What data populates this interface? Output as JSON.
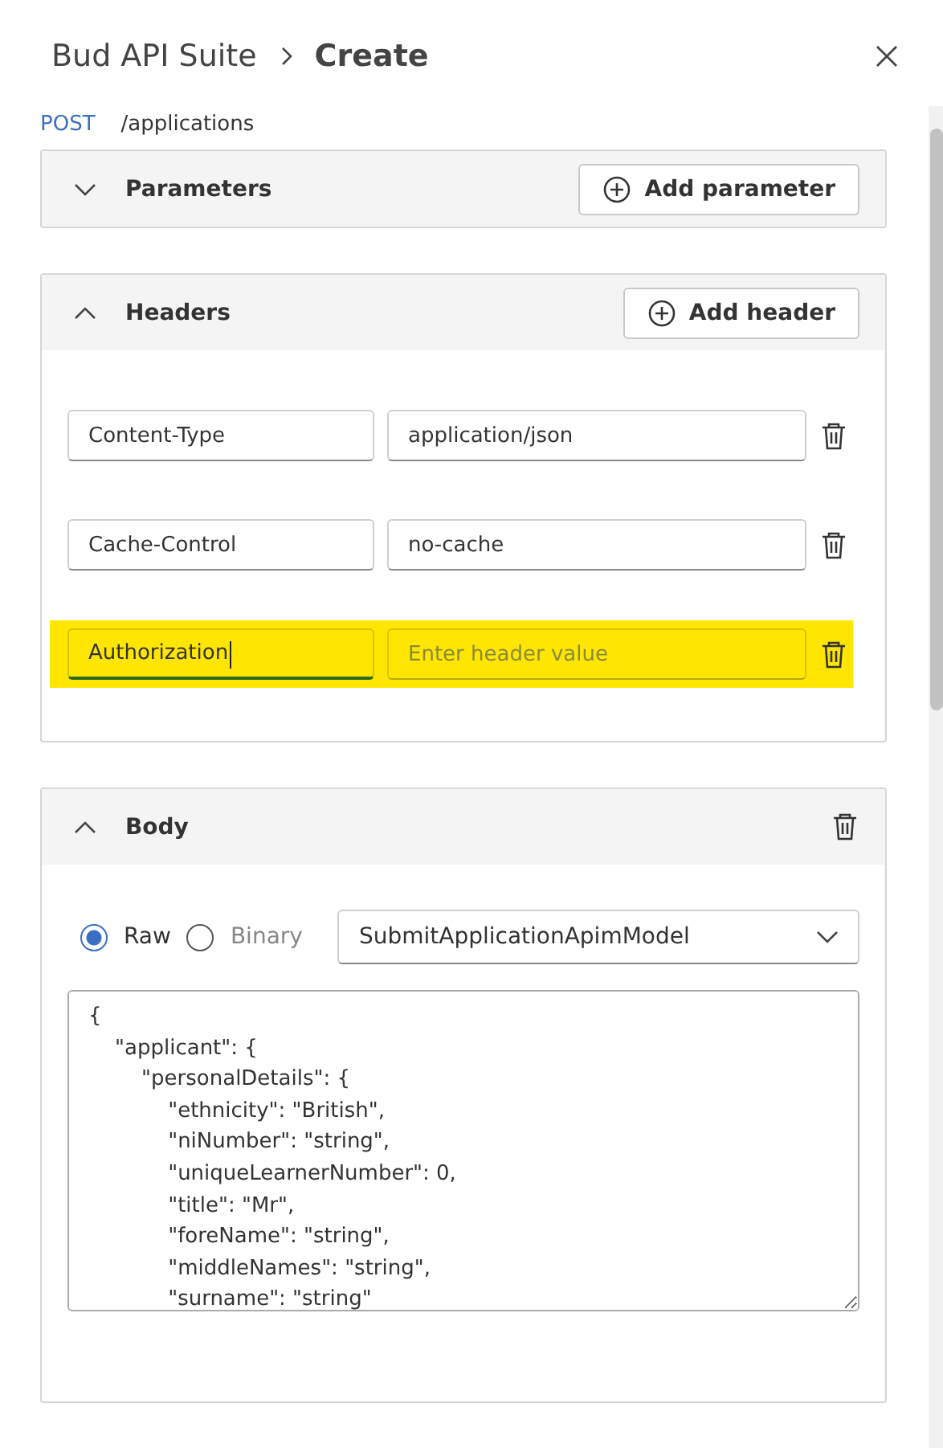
{
  "breadcrumb": {
    "parent": "Bud API Suite",
    "current": "Create"
  },
  "request": {
    "method": "POST",
    "path": "/applications"
  },
  "sections": [
    {
      "kind": "parameters",
      "title": "Parameters",
      "expanded": false,
      "action": "Add parameter"
    },
    {
      "kind": "headers",
      "title": "Headers",
      "expanded": true,
      "action": "Add header",
      "headers": [
        {
          "name": "Content-Type",
          "value": "application/json",
          "highlighted": false,
          "focused": false
        },
        {
          "name": "Cache-Control",
          "value": "no-cache",
          "highlighted": false,
          "focused": false
        },
        {
          "name": "Authorization",
          "placeholder": "Enter header value",
          "highlighted": true,
          "focused": true
        }
      ]
    },
    {
      "kind": "body",
      "title": "Body",
      "expanded": true,
      "modes": [
        {
          "label": "Raw",
          "selected": true
        },
        {
          "label": "Binary",
          "selected": false
        }
      ],
      "model": "SubmitApplicationApimModel",
      "content": "{\n    \"applicant\": {\n        \"personalDetails\": {\n            \"ethnicity\": \"British\",\n            \"niNumber\": \"string\",\n            \"uniqueLearnerNumber\": 0,\n            \"title\": \"Mr\",\n            \"foreName\": \"string\",\n            \"middleNames\": \"string\",\n            \"surname\": \"string\""
    }
  ]
}
